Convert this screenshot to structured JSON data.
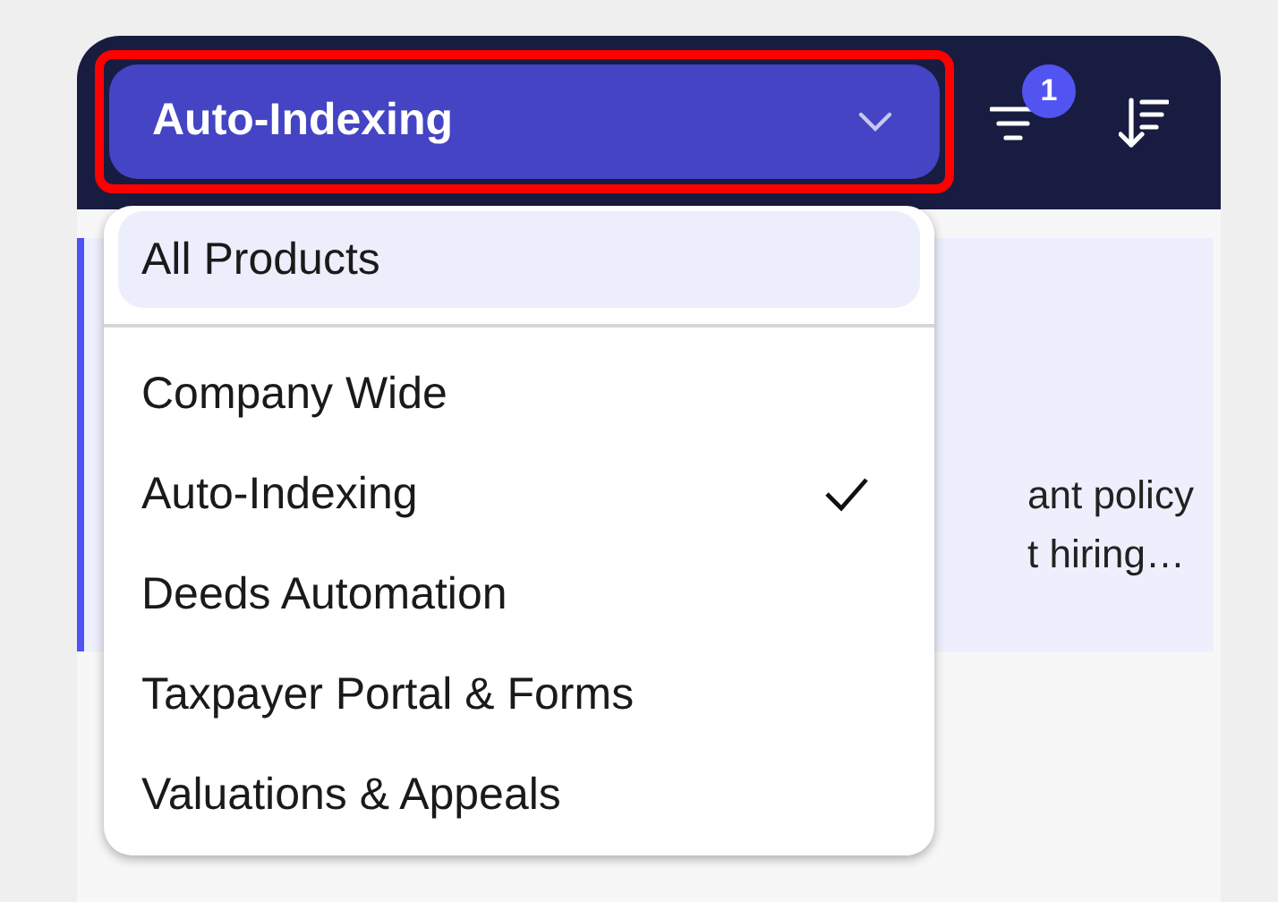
{
  "header": {
    "select": {
      "value": "Auto-Indexing",
      "open": true,
      "highlighted": true
    },
    "filter_badge": "1"
  },
  "card": {
    "lines": [
      "ant policy",
      "t hiring…"
    ]
  },
  "menu": {
    "all_option": {
      "label": "All Products",
      "highlighted": true,
      "selected": false
    },
    "options": [
      {
        "label": "Company Wide",
        "selected": false
      },
      {
        "label": "Auto-Indexing",
        "selected": true
      },
      {
        "label": "Deeds Automation",
        "selected": false
      },
      {
        "label": "Taxpayer Portal & Forms",
        "selected": false
      },
      {
        "label": "Valuations & Appeals",
        "selected": false
      }
    ]
  }
}
